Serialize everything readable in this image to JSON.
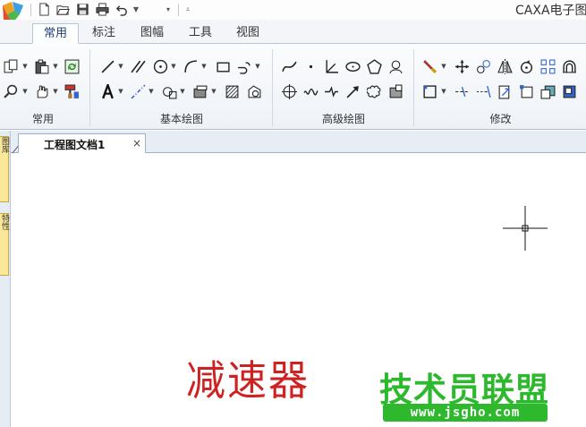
{
  "app": {
    "title": "CAXA电子图"
  },
  "quick_access": {
    "icons": [
      "new-file-icon",
      "open-folder-icon",
      "save-icon",
      "print-icon",
      "undo-icon",
      "customize-icon"
    ]
  },
  "ribbon_tabs": [
    {
      "label": "常用",
      "active": true
    },
    {
      "label": "标注",
      "active": false
    },
    {
      "label": "图幅",
      "active": false
    },
    {
      "label": "工具",
      "active": false
    },
    {
      "label": "视图",
      "active": false
    }
  ],
  "ribbon_groups": {
    "common": {
      "label": "常用"
    },
    "basic_draw": {
      "label": "基本绘图"
    },
    "advanced_draw": {
      "label": "高级绘图"
    },
    "modify": {
      "label": "修改"
    }
  },
  "document": {
    "tab_label": "工程图文档1",
    "close_glyph": "×"
  },
  "side_panel": {
    "tab1": "图库",
    "tab2": "特性"
  },
  "canvas": {
    "drawn_text": "减速器",
    "drawn_text_color": "#cc2222"
  },
  "watermark": {
    "text": "技术员联盟",
    "url": "www.jsgho.com",
    "color": "#2db82d"
  }
}
